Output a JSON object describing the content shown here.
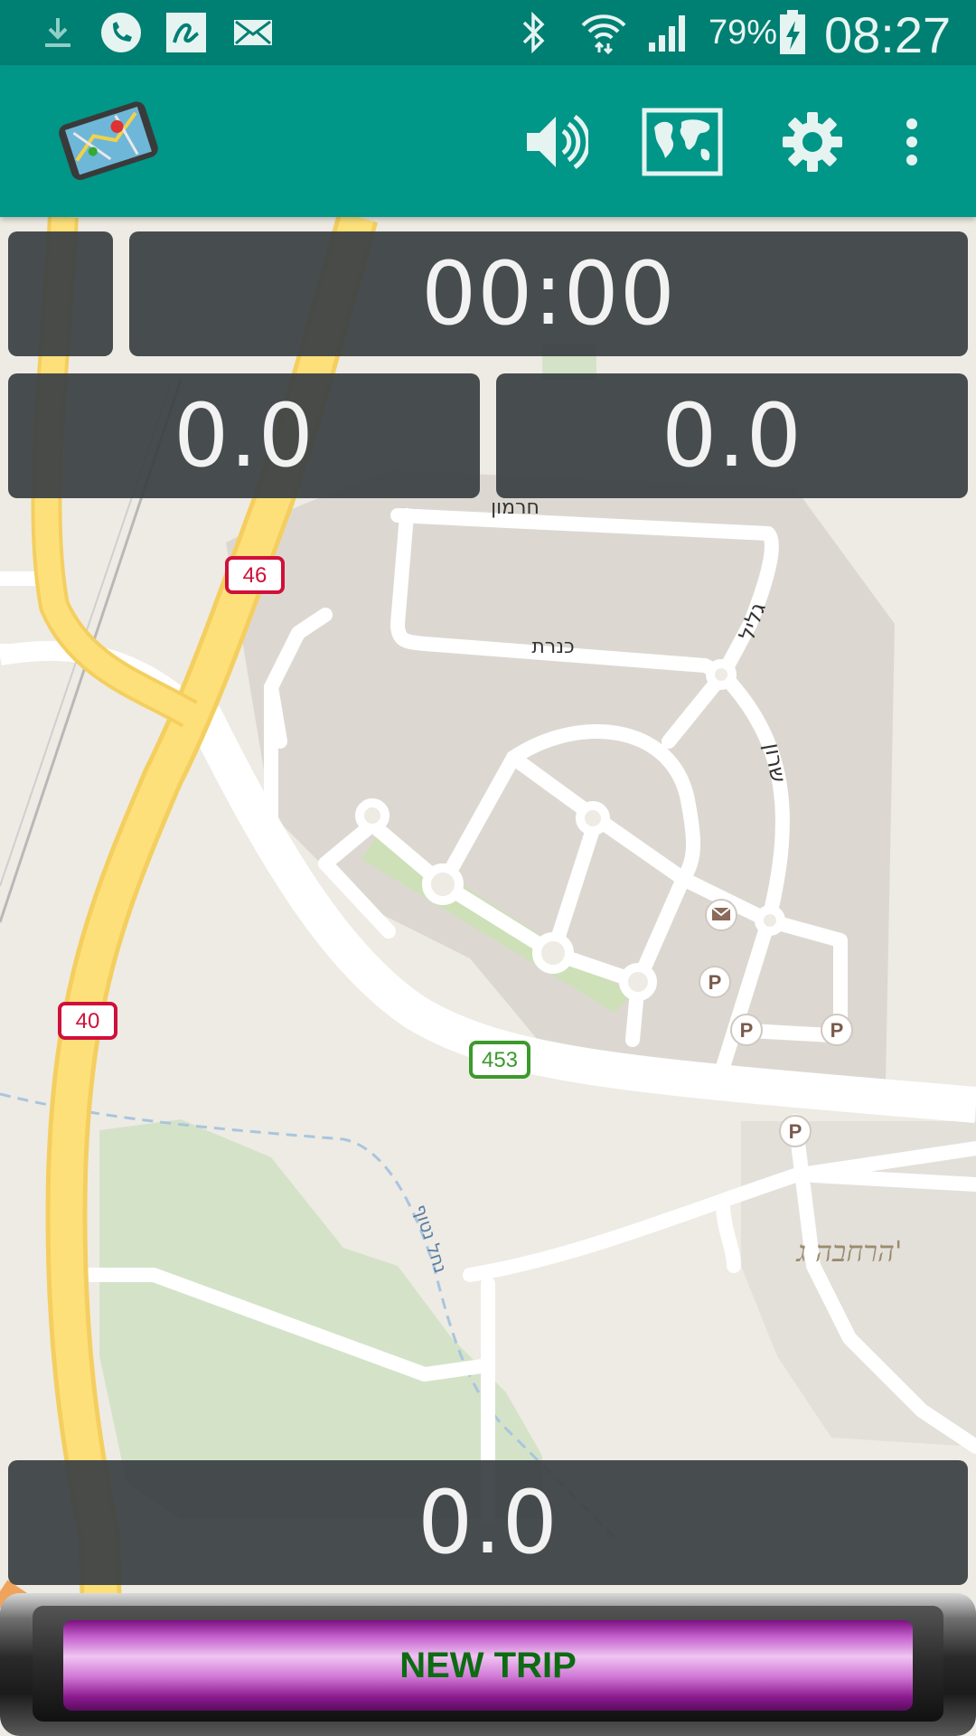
{
  "status_bar": {
    "battery": "79%",
    "time": "08:27",
    "icons": [
      "download-icon",
      "phone-icon",
      "signature-app-icon",
      "mail-icon",
      "bluetooth-icon",
      "wifi-icon",
      "signal-icon",
      "battery-charging-icon"
    ]
  },
  "toolbar": {
    "app_icon": "phone-map-logo",
    "actions": [
      "volume-icon",
      "map-icon",
      "settings-gear-icon",
      "overflow-menu-icon"
    ]
  },
  "panels": {
    "small_top": "",
    "timer": "00:00",
    "left_value": "0.0",
    "right_value": "0.0",
    "bottom_value": "0.0"
  },
  "map": {
    "road_shields": [
      {
        "label": "46",
        "color": "#d0103a"
      },
      {
        "label": "40",
        "color": "#d0103a"
      },
      {
        "label": "453",
        "color": "#3b9a2a"
      }
    ],
    "street_labels": [
      "חרמון",
      "כנרת",
      "גליל",
      "שרון",
      "נחל נטוף"
    ],
    "area_label": "הרחבה ג'",
    "poi": [
      "post-office-icon",
      "parking-icon",
      "parking-icon",
      "parking-icon",
      "parking-icon"
    ]
  },
  "button": {
    "label": "NEW TRIP"
  }
}
